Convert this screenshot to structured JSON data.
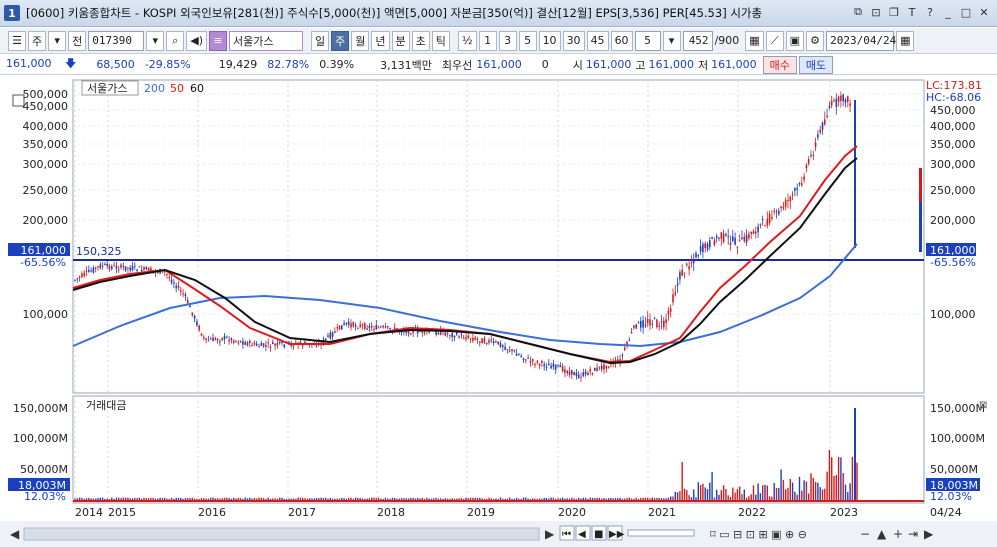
{
  "window": {
    "number": "1",
    "title": "[0600] 키움종합차트 - KOSPI 외국인보유[281(천)] 주식수[5,000(천)] 액면[5,000] 자본금[350(억)] 결산[12월] EPS[3,536] PER[45.53] 시가총"
  },
  "toolbar": {
    "type_1": "주",
    "type_2": "전",
    "code": "017390",
    "stock_name": "서울가스",
    "periods": [
      "일",
      "주",
      "월",
      "년",
      "분",
      "초",
      "틱"
    ],
    "active_period": "주",
    "fraction": "½",
    "intervals": [
      "1",
      "3",
      "5",
      "10",
      "30",
      "45",
      "60"
    ],
    "interval_value": "5",
    "count": "452",
    "count_total": "/900",
    "date": "2023/04/24"
  },
  "quote": {
    "price": "161,000",
    "change": "68,500",
    "change_pct": "-29.85%",
    "volume": "19,429",
    "vol_ratio": "82.78%",
    "turnover": "0.39%",
    "amount": "3,131백만",
    "best_bid_label": "최우선",
    "best_bid": "161,000",
    "zero": "0",
    "open_label": "시",
    "open": "161,000",
    "high_label": "고",
    "high": "161,000",
    "low_label": "저",
    "low": "161,000",
    "buy": "매수",
    "sell": "매도"
  },
  "price_chart": {
    "legend_name": "서울가스",
    "ma_labels": [
      "200",
      "50",
      "60"
    ],
    "lc_label": "LC:173.81",
    "hc_label": "HC:-68.06",
    "y_ticks_left": [
      "500,000",
      "450,000",
      "400,000",
      "350,000",
      "300,000",
      "250,000",
      "200,000",
      "100,000"
    ],
    "y_ticks_right": [
      "450,000",
      "400,000",
      "350,000",
      "300,000",
      "250,000",
      "200,000",
      "100,000"
    ],
    "current_price_label": "161,000",
    "current_pct_label": "-65.56%",
    "ref_line_label": "150,325"
  },
  "volume_chart": {
    "title": "거래대금",
    "y_ticks": [
      "150,000M",
      "100,000M",
      "50,000M"
    ],
    "current_label": "18,003M",
    "current_pct": "12.03%"
  },
  "x_axis": {
    "labels": [
      "2014",
      "2015",
      "2016",
      "2017",
      "2018",
      "2019",
      "2020",
      "2021",
      "2022",
      "2023"
    ],
    "right_label": "04/24"
  },
  "colors": {
    "candle_up": "#d21b1b",
    "candle_down": "#1a3fbf",
    "ma_200": "#3a6fd8",
    "ma_50": "#e01b1b",
    "ma_60": "#111111",
    "ref_line": "#1a2a9c",
    "label_bg": "#1a3fbf"
  }
}
